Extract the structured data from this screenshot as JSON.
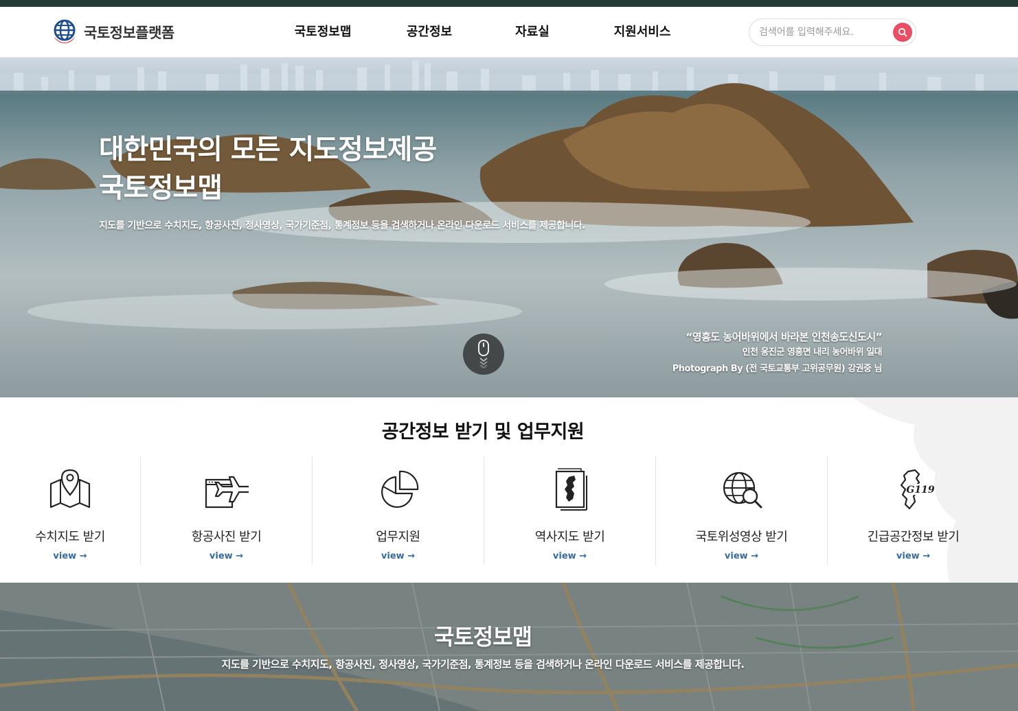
{
  "header": {
    "logo_text": "국토정보플랫폼",
    "nav": [
      {
        "label": "국토정보맵"
      },
      {
        "label": "공간정보"
      },
      {
        "label": "자료실"
      },
      {
        "label": "지원서비스"
      }
    ],
    "search": {
      "placeholder": "검색어를 입력해주세요.",
      "value": ""
    }
  },
  "hero": {
    "title_line1": "대한민국의 모든 지도정보제공",
    "title_line2": "국토정보맵",
    "subtitle": "지도를 기반으로 수치지도, 항공사진, 정사영상, 국가기준점, 통계정보 등을 검색하거나 온라인 다운로드 서비스를 제공합니다.",
    "caption": {
      "title": "“영흥도 농어바위에서 바라본 인천송도신도시”",
      "location": "인천 옹진군 영흥면 내리 농어바위 일대",
      "credit": "Photograph By (전 국토교통부 고위공무원) 강권중 님"
    }
  },
  "services": {
    "title": "공간정보 받기 및 업무지원",
    "view_label": "view →",
    "items": [
      {
        "label": "수치지도 받기",
        "icon": "map-pin-icon"
      },
      {
        "label": "항공사진 받기",
        "icon": "airplane-icon"
      },
      {
        "label": "업무지원",
        "icon": "pie-chart-icon"
      },
      {
        "label": "역사지도 받기",
        "icon": "korea-map-document-icon"
      },
      {
        "label": "국토위성영상 받기",
        "icon": "globe-search-icon"
      },
      {
        "label": "긴급공간정보 받기",
        "icon": "g119-korea-icon",
        "icon_text": "G119"
      }
    ]
  },
  "map_section": {
    "title": "국토정보맵",
    "subtitle": "지도를 기반으로 수치지도, 항공사진, 정사영상, 국가기준점, 통계정보 등을 검색하거나 온라인 다운로드 서비스를 제공합니다."
  },
  "colors": {
    "topbar": "#233a35",
    "search_button": "#e94f64",
    "view_link": "#356aa3"
  }
}
